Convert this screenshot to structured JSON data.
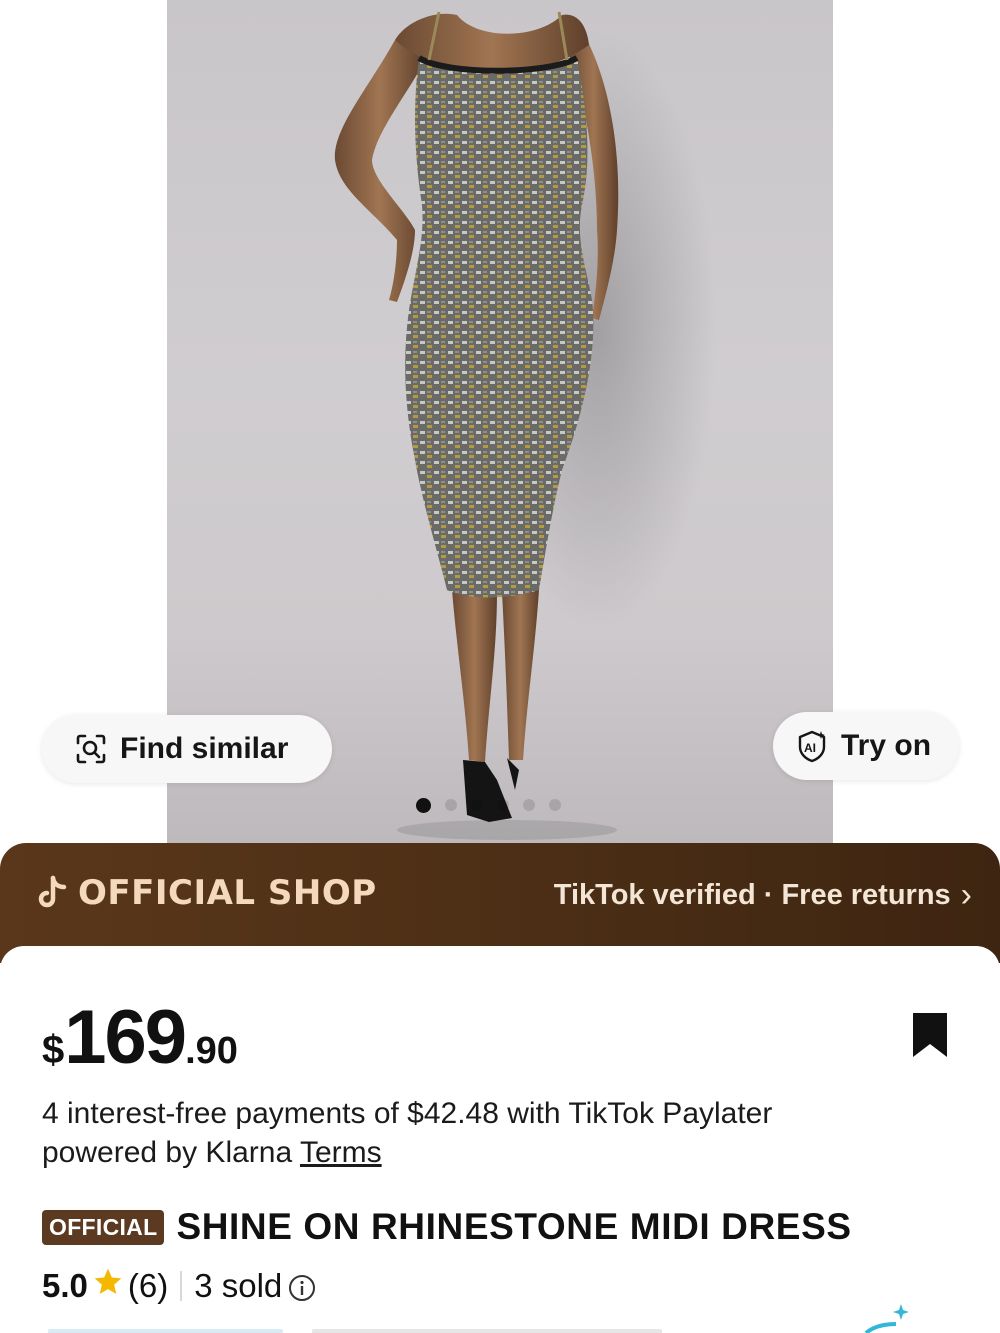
{
  "gallery": {
    "find_similar_label": "Find similar",
    "try_on_label": "Try on",
    "ai_badge_text": "AI",
    "total_images": 6,
    "active_index": 0
  },
  "shop_banner": {
    "label": "OFFICIAL SHOP",
    "verified": "TikTok verified",
    "separator": "·",
    "returns": "Free returns",
    "chevron": "›"
  },
  "product": {
    "currency": "$",
    "price_int": "169",
    "price_dec": ".90",
    "paylater_line1": "4 interest-free payments of $42.48 with  TikTok Paylater",
    "paylater_line2": "powered by Klarna ",
    "terms_label": "Terms",
    "badge": "OFFICIAL",
    "title": "SHINE ON RHINESTONE MIDI DRESS",
    "rating": "5.0",
    "review_count": "(6)",
    "sold": "3 sold"
  },
  "colors": {
    "shop_bar": "#4e3016",
    "badge": "#5c3a21",
    "star": "#f5b800",
    "shop_text": "#f4d9bd"
  },
  "icons": {
    "find_similar": "image-search-icon",
    "try_on": "ai-sparkle-icon",
    "shop": "tiktok-logo-icon",
    "save": "bookmark-icon",
    "star": "star-icon",
    "info": "info-icon"
  }
}
